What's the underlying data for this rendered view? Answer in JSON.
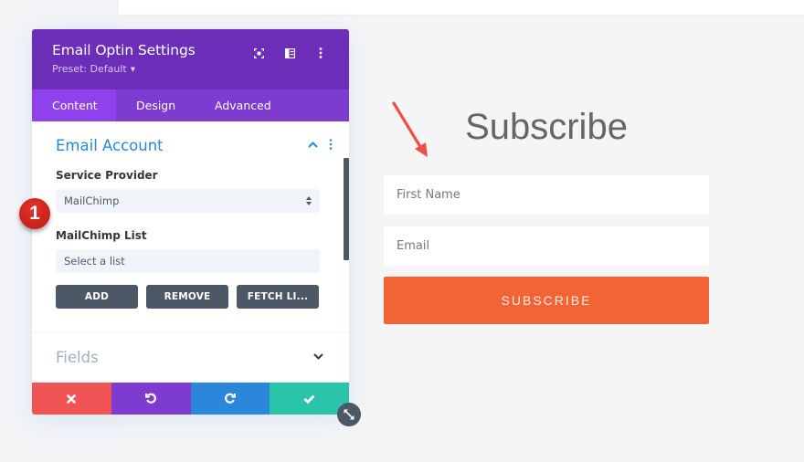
{
  "panel": {
    "title": "Email Optin Settings",
    "preset_label": "Preset: Default",
    "header_icons": [
      "focus-icon",
      "split-view-icon",
      "more-options-icon"
    ],
    "tabs": [
      {
        "label": "Content",
        "active": true
      },
      {
        "label": "Design",
        "active": false
      },
      {
        "label": "Advanced",
        "active": false
      }
    ],
    "sections": {
      "email_account": {
        "title": "Email Account",
        "expanded": true,
        "service_provider_label": "Service Provider",
        "service_provider_value": "MailChimp",
        "list_label": "MailChimp List",
        "list_value": "Select a list",
        "buttons": {
          "add": "ADD",
          "remove": "REMOVE",
          "fetch": "FETCH LI..."
        }
      },
      "fields": {
        "title": "Fields",
        "expanded": false
      }
    },
    "footer": {
      "cancel_color": "#ef5555",
      "undo_color": "#7e3bd0",
      "redo_color": "#2b87da",
      "save_color": "#29c4a9"
    }
  },
  "annotation": {
    "step_number": "1"
  },
  "preview": {
    "title": "Subscribe",
    "first_name_placeholder": "First Name",
    "email_placeholder": "Email",
    "button_label": "SUBSCRIBE",
    "button_color": "#f26335"
  }
}
